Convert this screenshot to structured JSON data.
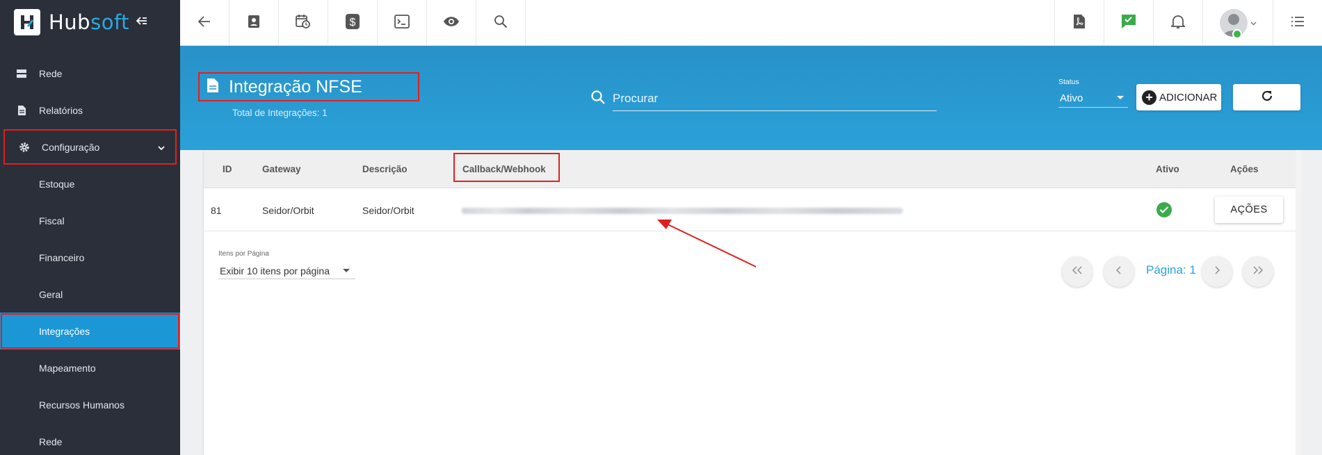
{
  "app": {
    "logo_text_part1": "Hub",
    "logo_text_part2": "soft"
  },
  "colors": {
    "sidebar_bg": "#2b2f3a",
    "accent": "#1b97d6",
    "header_blue": "#2aa1d9",
    "annotation_red": "#e02020",
    "status_ok": "#3bab4a"
  },
  "sidebar": {
    "items": [
      {
        "label": "Rede",
        "icon": "server-icon"
      },
      {
        "label": "Relatórios",
        "icon": "document-icon"
      },
      {
        "label": "Configuração",
        "icon": "gear-icon",
        "expanded": true
      },
      {
        "label": "Estoque"
      },
      {
        "label": "Fiscal"
      },
      {
        "label": "Financeiro"
      },
      {
        "label": "Geral"
      },
      {
        "label": "Integrações",
        "active": true
      },
      {
        "label": "Mapeamento"
      },
      {
        "label": "Recursos Humanos"
      },
      {
        "label": "Rede"
      }
    ]
  },
  "topbar": {
    "left_icons": [
      "back-arrow-icon",
      "contact-card-icon",
      "calendar-clock-icon",
      "dollar-icon",
      "terminal-icon",
      "eye-icon",
      "search-icon"
    ],
    "right_icons": [
      "pdf-icon",
      "chat-check-icon",
      "bell-icon",
      "avatar",
      "list-menu-icon"
    ]
  },
  "header": {
    "title": "Integração NFSE",
    "subtitle": "Total de Integrações: 1",
    "search_placeholder": "Procurar",
    "status_label": "Status",
    "status_value": "Ativo",
    "add_button": "ADICIONAR"
  },
  "table": {
    "columns": [
      "ID",
      "Gateway",
      "Descrição",
      "Callback/Webhook",
      "Ativo",
      "Ações"
    ],
    "rows": [
      {
        "id": "81",
        "gateway": "Seidor/Orbit",
        "descricao": "Seidor/Orbit",
        "callback": "",
        "ativo": true,
        "acoes_label": "AÇÕES"
      }
    ]
  },
  "pagination": {
    "per_page_label": "Itens por Página",
    "per_page_value": "Exibir 10 itens por página",
    "page_text": "Página: 1"
  }
}
